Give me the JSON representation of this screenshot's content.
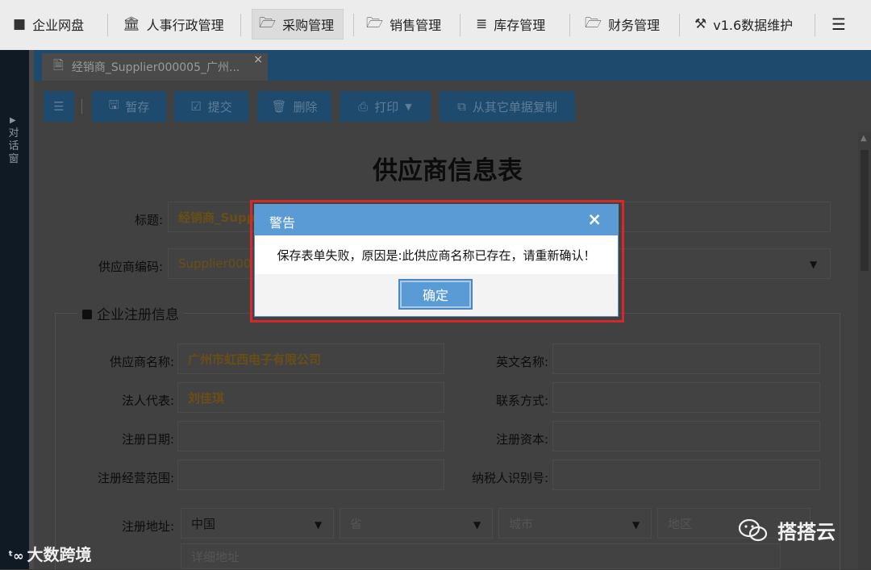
{
  "topnav": {
    "items": [
      {
        "icon": "folder-icon",
        "glyph": "■",
        "label": "企业网盘"
      },
      {
        "icon": "bank-icon",
        "glyph": "🏛",
        "label": "人事行政管理"
      },
      {
        "icon": "folder-open-icon",
        "glyph": "🗁",
        "label": "采购管理",
        "active": true
      },
      {
        "icon": "folder-open-icon",
        "glyph": "🗁",
        "label": "销售管理"
      },
      {
        "icon": "database-icon",
        "glyph": "≣",
        "label": "库存管理"
      },
      {
        "icon": "folder-open-icon",
        "glyph": "🗁",
        "label": "财务管理"
      },
      {
        "icon": "hammer-icon",
        "glyph": "⚒",
        "label": "v1.6数据维护"
      }
    ],
    "menu_glyph": "☰"
  },
  "leftstrip": {
    "label": "对话窗"
  },
  "doctab": {
    "label": "经销商_Supplier000005_广州...",
    "close": "×"
  },
  "toolbar": {
    "list_glyph": "☰",
    "save": "暂存",
    "submit": "提交",
    "delete": "删除",
    "print": "打印",
    "copy": "从其它单据复制"
  },
  "form": {
    "title": "供应商信息表",
    "title_label": "标题:",
    "title_value": "经销商_Supp",
    "code_label": "供应商编码:",
    "code_value": "Supplier000",
    "section": "企业注册信息",
    "name_label": "供应商名称:",
    "name_value": "广州市虹西电子有限公司",
    "en_label": "英文名称:",
    "legal_label": "法人代表:",
    "legal_value": "刘佳琪",
    "contact_label": "联系方式:",
    "reg_date_label": "注册日期:",
    "capital_label": "注册资本:",
    "scope_label": "注册经营范围:",
    "tax_label": "纳税人识别号:",
    "addr_label": "注册地址:",
    "country": "中国",
    "province": "省",
    "city": "城市",
    "district": "地区",
    "detail": "详细地址"
  },
  "dialog": {
    "title": "警告",
    "close": "×",
    "message": "保存表单失败，原因是:此供应商名称已存在，请重新确认！",
    "ok": "确定"
  },
  "watermarks": {
    "left": "大数跨境",
    "right": "搭搭云"
  }
}
